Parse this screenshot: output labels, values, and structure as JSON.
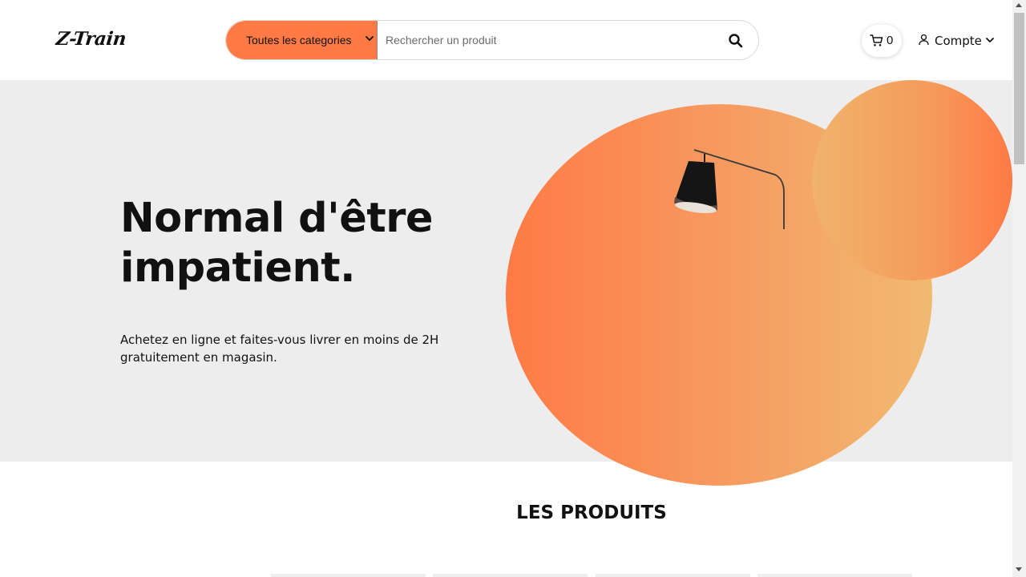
{
  "header": {
    "logo": "Z-Train",
    "category_select": {
      "selected": "Toutes les categories"
    },
    "search": {
      "placeholder": "Rechercher un produit",
      "value": ""
    },
    "cart": {
      "count": "0"
    },
    "account": {
      "label": "Compte"
    }
  },
  "hero": {
    "title_line1": "Normal d'être",
    "title_line2": "impatient.",
    "subtitle": "Achetez en ligne et faites-vous livrer en moins de 2H gratuitement en magasin."
  },
  "products": {
    "section_title": "LES PRODUITS"
  },
  "colors": {
    "accent": "#ff7a45",
    "hero_background": "#ededed",
    "gradient_light": "#f1ba70"
  },
  "icons": [
    "chevron-down-icon",
    "search-icon",
    "cart-icon",
    "user-icon",
    "lamp-illustration"
  ]
}
